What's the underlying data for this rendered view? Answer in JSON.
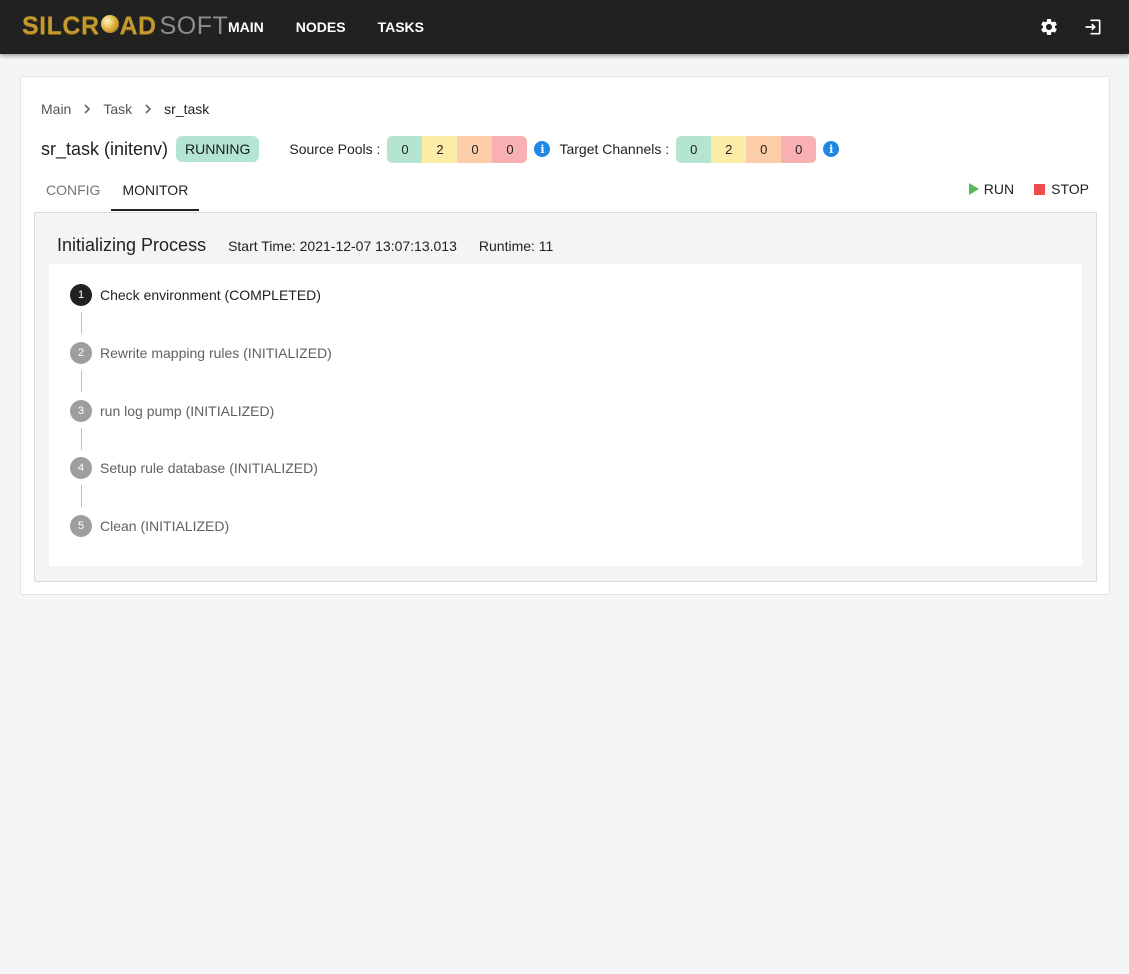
{
  "brand": {
    "part1": "SILCR",
    "part2": "AD",
    "part3": "SOFT"
  },
  "nav": {
    "items": [
      {
        "label": "MAIN"
      },
      {
        "label": "NODES"
      },
      {
        "label": "TASKS"
      }
    ]
  },
  "icons": {
    "settings": "gear-icon",
    "logout": "logout-icon",
    "info": "info-icon"
  },
  "breadcrumb": [
    {
      "label": "Main"
    },
    {
      "label": "Task"
    },
    {
      "label": "sr_task"
    }
  ],
  "task": {
    "title": "sr_task (initenv)",
    "status": "RUNNING"
  },
  "source_pools": {
    "label": "Source Pools :",
    "counts": [
      "0",
      "2",
      "0",
      "0"
    ]
  },
  "target_channels": {
    "label": "Target Channels :",
    "counts": [
      "0",
      "2",
      "0",
      "0"
    ]
  },
  "tabs": [
    {
      "label": "CONFIG"
    },
    {
      "label": "MONITOR"
    }
  ],
  "actions": {
    "run": "RUN",
    "stop": "STOP"
  },
  "monitor": {
    "title": "Initializing Process",
    "start_time": "Start Time: 2021-12-07 13:07:13.013",
    "runtime": "Runtime: 11",
    "steps": [
      {
        "number": "1",
        "label": "Check environment (COMPLETED)"
      },
      {
        "number": "2",
        "label": "Rewrite mapping rules (INITIALIZED)"
      },
      {
        "number": "3",
        "label": "run log pump (INITIALIZED)"
      },
      {
        "number": "4",
        "label": "Setup rule database (INITIALIZED)"
      },
      {
        "number": "5",
        "label": "Clean (INITIALIZED)"
      }
    ]
  },
  "colors": {
    "topbar": "#212121",
    "status_badge": "#b4e5d2",
    "count_green": "#b5e4d1",
    "count_yellow": "#fbeda8",
    "count_orange": "#fccda6",
    "count_red": "#f8b0b3",
    "run": "#5cb85c",
    "stop": "#ef4c4c",
    "info": "#1e88e5"
  }
}
